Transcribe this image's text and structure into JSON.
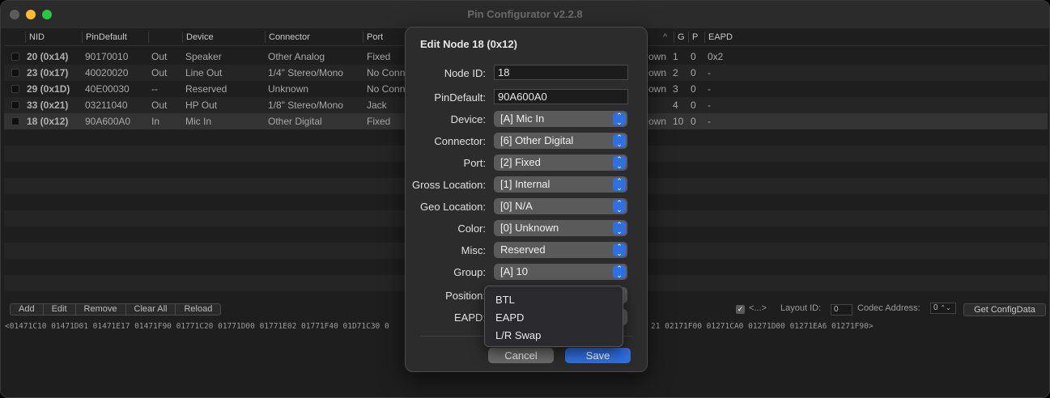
{
  "window": {
    "title": "Pin Configurator v2.2.8"
  },
  "table": {
    "columns_left": [
      "NID",
      "PinDefault",
      "Device",
      "Connector",
      "Port"
    ],
    "columns_right": [
      "G",
      "P",
      "EAPD"
    ],
    "rows": [
      {
        "nid": "20 (0x14)",
        "pindefault": "90170010",
        "dir": "Out",
        "device": "Speaker",
        "connector": "Other Analog",
        "port": "Fixed",
        "loc": "own",
        "g": "1",
        "p": "0",
        "eapd": "0x2"
      },
      {
        "nid": "23 (0x17)",
        "pindefault": "40020020",
        "dir": "Out",
        "device": "Line Out",
        "connector": "1/4\" Stereo/Mono",
        "port": "No Conn",
        "loc": "own",
        "g": "2",
        "p": "0",
        "eapd": "-"
      },
      {
        "nid": "29 (0x1D)",
        "pindefault": "40E00030",
        "dir": "--",
        "device": "Reserved",
        "connector": "Unknown",
        "port": "No Conn",
        "loc": "own",
        "g": "3",
        "p": "0",
        "eapd": "-"
      },
      {
        "nid": "33 (0x21)",
        "pindefault": "03211040",
        "dir": "Out",
        "device": "HP Out",
        "connector": "1/8\" Stereo/Mono",
        "port": "Jack",
        "loc": "",
        "g": "4",
        "p": "0",
        "eapd": "-"
      },
      {
        "nid": "18 (0x12)",
        "pindefault": "90A600A0",
        "dir": "In",
        "device": "Mic In",
        "connector": "Other Digital",
        "port": "Fixed",
        "loc": "own",
        "g": "10",
        "p": "0",
        "eapd": "-"
      }
    ]
  },
  "toolbar": {
    "add": "Add",
    "edit": "Edit",
    "remove": "Remove",
    "clear_all": "Clear All",
    "reload": "Reload",
    "swap_label": "<...>",
    "layout_id_label": "Layout ID:",
    "layout_id_value": "0",
    "codec_address_label": "Codec Address:",
    "codec_address_value": "0",
    "get_config": "Get ConfigData"
  },
  "config_data": {
    "left": "<01471C10 01471D01 01471E17 01471F90 01771C20 01771D00 01771E02 01771F40 01D71C30 0",
    "right": "21 02171F00 01271CA0 01271D00 01271EA6 01271F90>"
  },
  "dialog": {
    "title": "Edit Node 18 (0x12)",
    "node_id_label": "Node ID:",
    "node_id": "18",
    "pindefault_label": "PinDefault:",
    "pindefault": "90A600A0",
    "device_label": "Device:",
    "device": "[A] Mic In",
    "connector_label": "Connector:",
    "connector": "[6] Other Digital",
    "port_label": "Port:",
    "port": "[2] Fixed",
    "gross_location_label": "Gross Location:",
    "gross_location": "[1] Internal",
    "geo_location_label": "Geo Location:",
    "geo_location": "[0] N/A",
    "color_label": "Color:",
    "color": "[0] Unknown",
    "misc_label": "Misc:",
    "misc": "Reserved",
    "group_label": "Group:",
    "group": "[A] 10",
    "position_label": "Position:",
    "eapd_label": "EAPD:",
    "cancel": "Cancel",
    "save": "Save"
  },
  "eapd_menu": {
    "items": [
      "BTL",
      "EAPD",
      "L/R Swap"
    ]
  },
  "colors": {
    "accent": "#2f6fe0",
    "window_bg": "#1e1e1e",
    "dialog_bg": "#2c2c2c"
  }
}
